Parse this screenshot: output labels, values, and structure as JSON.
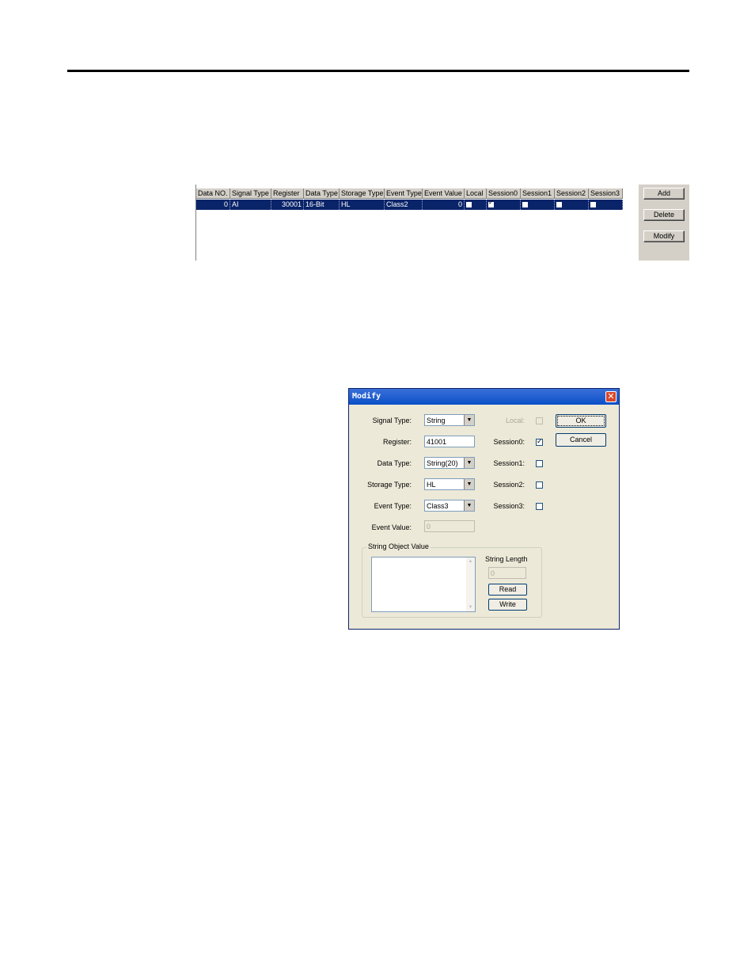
{
  "grid": {
    "columns": [
      "Data NO.",
      "Signal Type",
      "Register",
      "Data Type",
      "Storage Type",
      "Event Type",
      "Event Value",
      "Local",
      "Session0",
      "Session1",
      "Session2",
      "Session3"
    ],
    "row": {
      "data_no": "0",
      "signal_type": "AI",
      "register": "30001",
      "data_type": "16-Bit",
      "storage_type": "HL",
      "event_type": "Class2",
      "event_value": "0",
      "local": false,
      "session0": true,
      "session1": false,
      "session2": false,
      "session3": false
    },
    "buttons": {
      "add": "Add",
      "delete": "Delete",
      "modify": "Modify"
    }
  },
  "dialog": {
    "title": "Modify",
    "fields": {
      "signal_type_label": "Signal Type:",
      "signal_type_value": "String",
      "register_label": "Register:",
      "register_value": "41001",
      "data_type_label": "Data Type:",
      "data_type_value": "String(20)",
      "storage_type_label": "Storage Type:",
      "storage_type_value": "HL",
      "event_type_label": "Event Type:",
      "event_type_value": "Class3",
      "event_value_label": "Event Value:",
      "event_value_value": "0"
    },
    "checks": {
      "local_label": "Local:",
      "session0_label": "Session0:",
      "session1_label": "Session1:",
      "session2_label": "Session2:",
      "session3_label": "Session3:",
      "local": false,
      "session0": true,
      "session1": false,
      "session2": false,
      "session3": false
    },
    "buttons": {
      "ok": "OK",
      "cancel": "Cancel",
      "read": "Read",
      "write": "Write"
    },
    "string_group": {
      "label": "String Object Value",
      "length_label": "String Length",
      "length_value": "0"
    },
    "colors": {
      "title_bar": "#0a50c8",
      "selection": "#0a246a",
      "face": "#ece9d8"
    }
  }
}
